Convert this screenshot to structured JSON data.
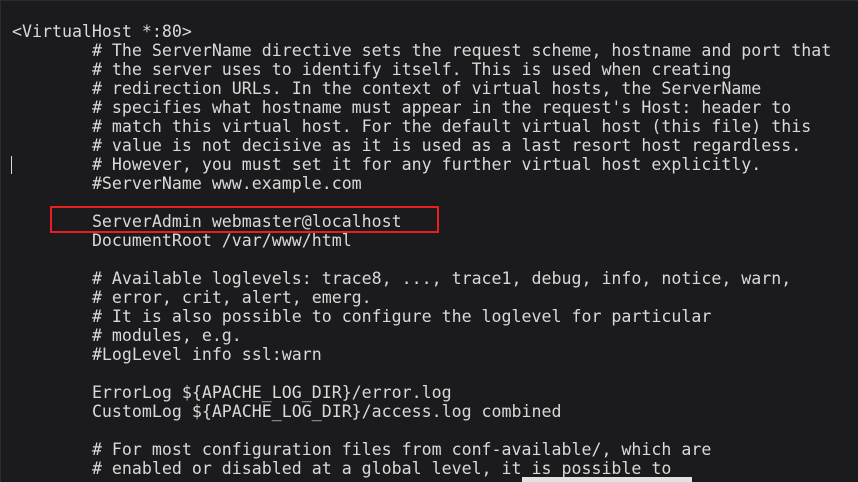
{
  "editor": {
    "lines": [
      "<VirtualHost *:80>",
      "\t# The ServerName directive sets the request scheme, hostname and port that",
      "\t# the server uses to identify itself. This is used when creating",
      "\t# redirection URLs. In the context of virtual hosts, the ServerName",
      "\t# specifies what hostname must appear in the request's Host: header to",
      "\t# match this virtual host. For the default virtual host (this file) this",
      "\t# value is not decisive as it is used as a last resort host regardless.",
      "\t# However, you must set it for any further virtual host explicitly.",
      "\t#ServerName www.example.com",
      "",
      "\tServerAdmin webmaster@localhost",
      "\tDocumentRoot /var/www/html",
      "",
      "\t# Available loglevels: trace8, ..., trace1, debug, info, notice, warn,",
      "\t# error, crit, alert, emerg.",
      "\t# It is also possible to configure the loglevel for particular",
      "\t# modules, e.g.",
      "\t#LogLevel info ssl:warn",
      "",
      "\tErrorLog ${APACHE_LOG_DIR}/error.log",
      "\tCustomLog ${APACHE_LOG_DIR}/access.log combined",
      "",
      "\t# For most configuration files from conf-available/, which are",
      "\t# enabled or disabled at a global level, it is possible to"
    ],
    "highlighted_line": 10,
    "highlight_color": "#e5201e",
    "text_color": "#d9d9d9",
    "background_color": "#1b1b1d"
  }
}
